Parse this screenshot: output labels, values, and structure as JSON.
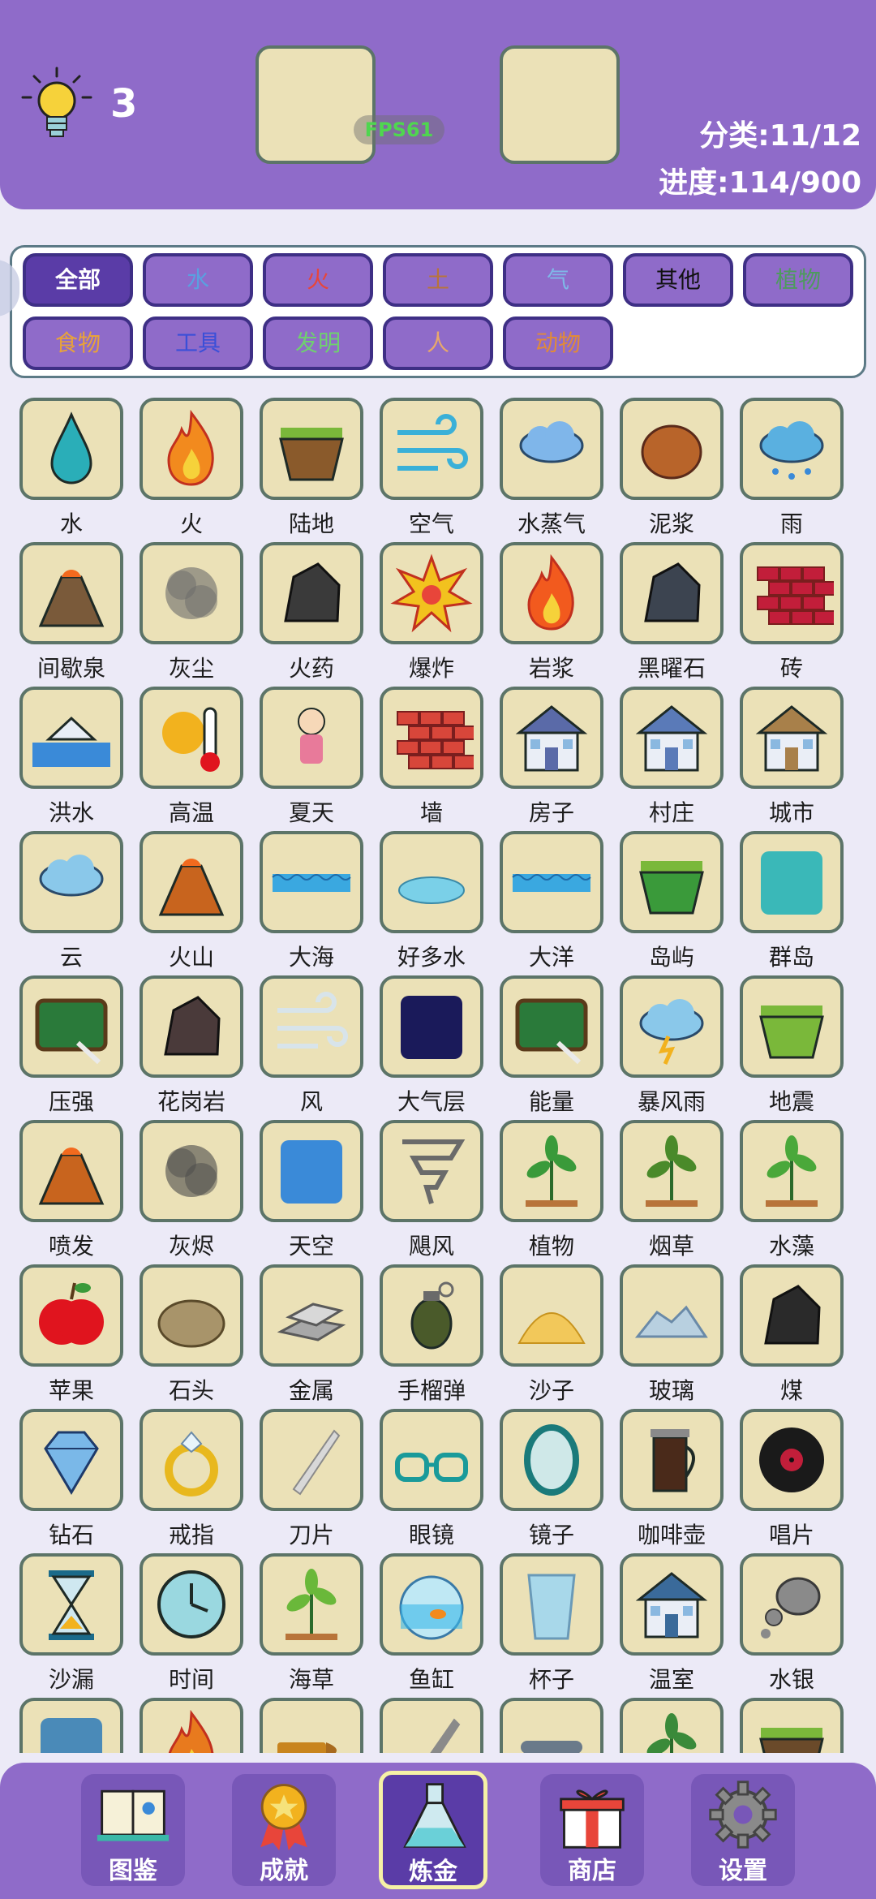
{
  "header": {
    "hint_count": "3",
    "fps": "FPS61",
    "category_stat": "分类:11/12",
    "progress_stat": "进度:114/900"
  },
  "filters": [
    {
      "label": "全部",
      "color": "#ffffff",
      "active": true
    },
    {
      "label": "水",
      "color": "#5aa0e0"
    },
    {
      "label": "火",
      "color": "#e8453a"
    },
    {
      "label": "土",
      "color": "#b8743a"
    },
    {
      "label": "气",
      "color": "#7fb8e8"
    },
    {
      "label": "其他",
      "color": "#111111"
    },
    {
      "label": "植物",
      "color": "#4e9a5e"
    },
    {
      "label": "食物",
      "color": "#e8a23a"
    },
    {
      "label": "工具",
      "color": "#3a4fd8"
    },
    {
      "label": "发明",
      "color": "#6fd06f"
    },
    {
      "label": "人",
      "color": "#e8a86a"
    },
    {
      "label": "动物",
      "color": "#e08a3a"
    }
  ],
  "items": [
    {
      "label": "水",
      "icon": "water-drop-icon",
      "color": "#2aaeb8"
    },
    {
      "label": "火",
      "icon": "fire-icon",
      "color": "#f28a1e"
    },
    {
      "label": "陆地",
      "icon": "land-icon",
      "color": "#8a5a2b"
    },
    {
      "label": "空气",
      "icon": "air-icon",
      "color": "#3ab0d8"
    },
    {
      "label": "水蒸气",
      "icon": "steam-icon",
      "color": "#7fb6ea"
    },
    {
      "label": "泥浆",
      "icon": "mud-icon",
      "color": "#b8642a"
    },
    {
      "label": "雨",
      "icon": "rain-icon",
      "color": "#5ab0e0"
    },
    {
      "label": "间歇泉",
      "icon": "geyser-icon",
      "color": "#7a5a3a"
    },
    {
      "label": "灰尘",
      "icon": "dust-icon",
      "color": "#6a6a6a"
    },
    {
      "label": "火药",
      "icon": "gunpowder-icon",
      "color": "#3a3a3a"
    },
    {
      "label": "爆炸",
      "icon": "explosion-icon",
      "color": "#f2c21e"
    },
    {
      "label": "岩浆",
      "icon": "lava-icon",
      "color": "#f25a1e"
    },
    {
      "label": "黑曜石",
      "icon": "obsidian-icon",
      "color": "#3c4450"
    },
    {
      "label": "砖",
      "icon": "brick-icon",
      "color": "#c21e3a"
    },
    {
      "label": "洪水",
      "icon": "flood-icon",
      "color": "#3a8ad8"
    },
    {
      "label": "高温",
      "icon": "heat-icon",
      "color": "#f2b21e"
    },
    {
      "label": "夏天",
      "icon": "summer-icon",
      "color": "#e87a9a"
    },
    {
      "label": "墙",
      "icon": "wall-icon",
      "color": "#d8463a"
    },
    {
      "label": "房子",
      "icon": "house-icon",
      "color": "#5a6aa8"
    },
    {
      "label": "村庄",
      "icon": "village-icon",
      "color": "#5a7ab8"
    },
    {
      "label": "城市",
      "icon": "city-icon",
      "color": "#a8804a"
    },
    {
      "label": "云",
      "icon": "cloud-icon",
      "color": "#8ac8ea"
    },
    {
      "label": "火山",
      "icon": "volcano-icon",
      "color": "#c8641e"
    },
    {
      "label": "大海",
      "icon": "sea-icon",
      "color": "#3aa8e0"
    },
    {
      "label": "好多水",
      "icon": "puddle-icon",
      "color": "#7ad0e8"
    },
    {
      "label": "大洋",
      "icon": "ocean-icon",
      "color": "#3aa8e0"
    },
    {
      "label": "岛屿",
      "icon": "island-icon",
      "color": "#3a9a3a"
    },
    {
      "label": "群岛",
      "icon": "archipelago-icon",
      "color": "#3ab8b8"
    },
    {
      "label": "压强",
      "icon": "pressure-icon",
      "color": "#2a7a3a"
    },
    {
      "label": "花岗岩",
      "icon": "granite-icon",
      "color": "#4a3a3a"
    },
    {
      "label": "风",
      "icon": "wind-icon",
      "color": "#d8e4ea"
    },
    {
      "label": "大气层",
      "icon": "atmosphere-icon",
      "color": "#1a1a5a"
    },
    {
      "label": "能量",
      "icon": "energy-icon",
      "color": "#2a7a3a"
    },
    {
      "label": "暴风雨",
      "icon": "storm-icon",
      "color": "#8ac8ea"
    },
    {
      "label": "地震",
      "icon": "earthquake-icon",
      "color": "#7ab83a"
    },
    {
      "label": "喷发",
      "icon": "eruption-icon",
      "color": "#c8641e"
    },
    {
      "label": "灰烬",
      "icon": "ash-icon",
      "color": "#4a4a4a"
    },
    {
      "label": "天空",
      "icon": "sky-icon",
      "color": "#3a8ad8"
    },
    {
      "label": "飓风",
      "icon": "tornado-icon",
      "color": "#6a6a6a"
    },
    {
      "label": "植物",
      "icon": "plant-icon",
      "color": "#3a9a3a"
    },
    {
      "label": "烟草",
      "icon": "tobacco-icon",
      "color": "#4a8a2a"
    },
    {
      "label": "水藻",
      "icon": "seaweed-icon",
      "color": "#4aa83a"
    },
    {
      "label": "苹果",
      "icon": "apple-icon",
      "color": "#e0141e"
    },
    {
      "label": "石头",
      "icon": "stone-icon",
      "color": "#a8946a"
    },
    {
      "label": "金属",
      "icon": "metal-icon",
      "color": "#a8a8a8"
    },
    {
      "label": "手榴弹",
      "icon": "grenade-icon",
      "color": "#4a5a2a"
    },
    {
      "label": "沙子",
      "icon": "sand-icon",
      "color": "#f2c85a"
    },
    {
      "label": "玻璃",
      "icon": "glass-icon",
      "color": "#b8d0e0"
    },
    {
      "label": "煤",
      "icon": "coal-icon",
      "color": "#2a2a2a"
    },
    {
      "label": "钻石",
      "icon": "diamond-icon",
      "color": "#7ab8e8"
    },
    {
      "label": "戒指",
      "icon": "ring-icon",
      "color": "#e8b81e"
    },
    {
      "label": "刀片",
      "icon": "blade-icon",
      "color": "#d8d8d8"
    },
    {
      "label": "眼镜",
      "icon": "glasses-icon",
      "color": "#1a9a9a"
    },
    {
      "label": "镜子",
      "icon": "mirror-icon",
      "color": "#1a7a7a"
    },
    {
      "label": "咖啡壶",
      "icon": "coffee-pot-icon",
      "color": "#4a2a1a"
    },
    {
      "label": "唱片",
      "icon": "record-icon",
      "color": "#1a1a1a"
    },
    {
      "label": "沙漏",
      "icon": "hourglass-icon",
      "color": "#1a6a8a"
    },
    {
      "label": "时间",
      "icon": "clock-icon",
      "color": "#1a9aa8"
    },
    {
      "label": "海草",
      "icon": "seagrass-icon",
      "color": "#6ab83a"
    },
    {
      "label": "鱼缸",
      "icon": "fishbowl-icon",
      "color": "#3ab8e8"
    },
    {
      "label": "杯子",
      "icon": "cup-icon",
      "color": "#a8d8ea"
    },
    {
      "label": "温室",
      "icon": "greenhouse-icon",
      "color": "#3a6a9a"
    },
    {
      "label": "水银",
      "icon": "mercury-icon",
      "color": "#8a8a8a"
    },
    {
      "label": "",
      "icon": "rust-icon",
      "color": "#4a8ab8"
    },
    {
      "label": "",
      "icon": "lamp-icon",
      "color": "#e87a1e"
    },
    {
      "label": "",
      "icon": "bullet-icon",
      "color": "#c8841e"
    },
    {
      "label": "",
      "icon": "needle-icon",
      "color": "#8a8a8a"
    },
    {
      "label": "",
      "icon": "pipes-icon",
      "color": "#6a7a8a"
    },
    {
      "label": "",
      "icon": "bonsai-icon",
      "color": "#3a8a3a"
    },
    {
      "label": "",
      "icon": "soil-icon",
      "color": "#6a4a2a"
    }
  ],
  "nav": [
    {
      "label": "图鉴",
      "icon": "book-icon"
    },
    {
      "label": "成就",
      "icon": "medal-icon"
    },
    {
      "label": "炼金",
      "icon": "flask-icon",
      "active": true
    },
    {
      "label": "商店",
      "icon": "gift-icon"
    },
    {
      "label": "设置",
      "icon": "gear-icon"
    }
  ]
}
